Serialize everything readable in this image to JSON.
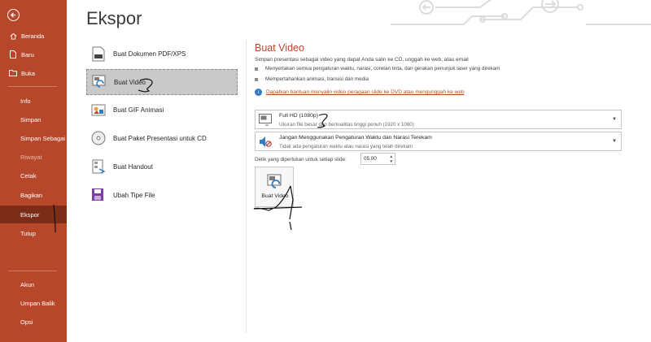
{
  "sidebar": {
    "back_label": "",
    "items": [
      {
        "label": "Beranda"
      },
      {
        "label": "Baru"
      },
      {
        "label": "Buka"
      },
      {
        "label": "Info"
      },
      {
        "label": "Simpan"
      },
      {
        "label": "Simpan Sebagai"
      },
      {
        "label": "Riwayat"
      },
      {
        "label": "Cetak"
      },
      {
        "label": "Bagikan"
      },
      {
        "label": "Ekspor"
      },
      {
        "label": "Tutup"
      },
      {
        "label": "Akun"
      },
      {
        "label": "Umpan Balik"
      },
      {
        "label": "Opsi"
      }
    ]
  },
  "main": {
    "title": "Ekspor",
    "options": [
      {
        "label": "Buat Dokumen PDF/XPS",
        "icon": "pdf-document-icon"
      },
      {
        "label": "Buat Video",
        "icon": "video-icon"
      },
      {
        "label": "Buat GIF Animasi",
        "icon": "gif-icon"
      },
      {
        "label": "Buat Paket Presentasi untuk CD",
        "icon": "cd-icon"
      },
      {
        "label": "Buat Handout",
        "icon": "handout-icon"
      },
      {
        "label": "Ubah Tipe File",
        "icon": "file-type-icon"
      }
    ]
  },
  "panel": {
    "title": "Buat Video",
    "description": "Simpan presentasi sebagai video yang dapat Anda salin ke CD, unggah ke web, atau email",
    "bullets": [
      "Menyertakan semua pengaturan waktu, narasi, coretan tinta, dan gerakan penunjuk laser yang direkam",
      "Mempertahankan animasi, transisi dan media"
    ],
    "help_link": "Dapatkan bantuan menyalin video peragaan slide ke DVD atau mengunggah ke web",
    "quality_dropdown": {
      "main": "Full HD (1080p)",
      "sub": "Ukuran file besar dan berkualitas tinggi penuh (1920 x 1080)"
    },
    "timing_dropdown": {
      "main": "Jangan Menggunakan Pengaturan Waktu dan Narasi Terekam",
      "sub": "Tidak ada pengaturan waktu atau narasi yang telah direkam"
    },
    "duration_label": "Detik yang diperlukan untuk setiap slide:",
    "duration_value": "05.00",
    "create_button_label": "Buat Video"
  },
  "colors": {
    "accent": "#b7472a",
    "active_nav": "#7c2d17",
    "selected_option": "#c9c9c9"
  }
}
